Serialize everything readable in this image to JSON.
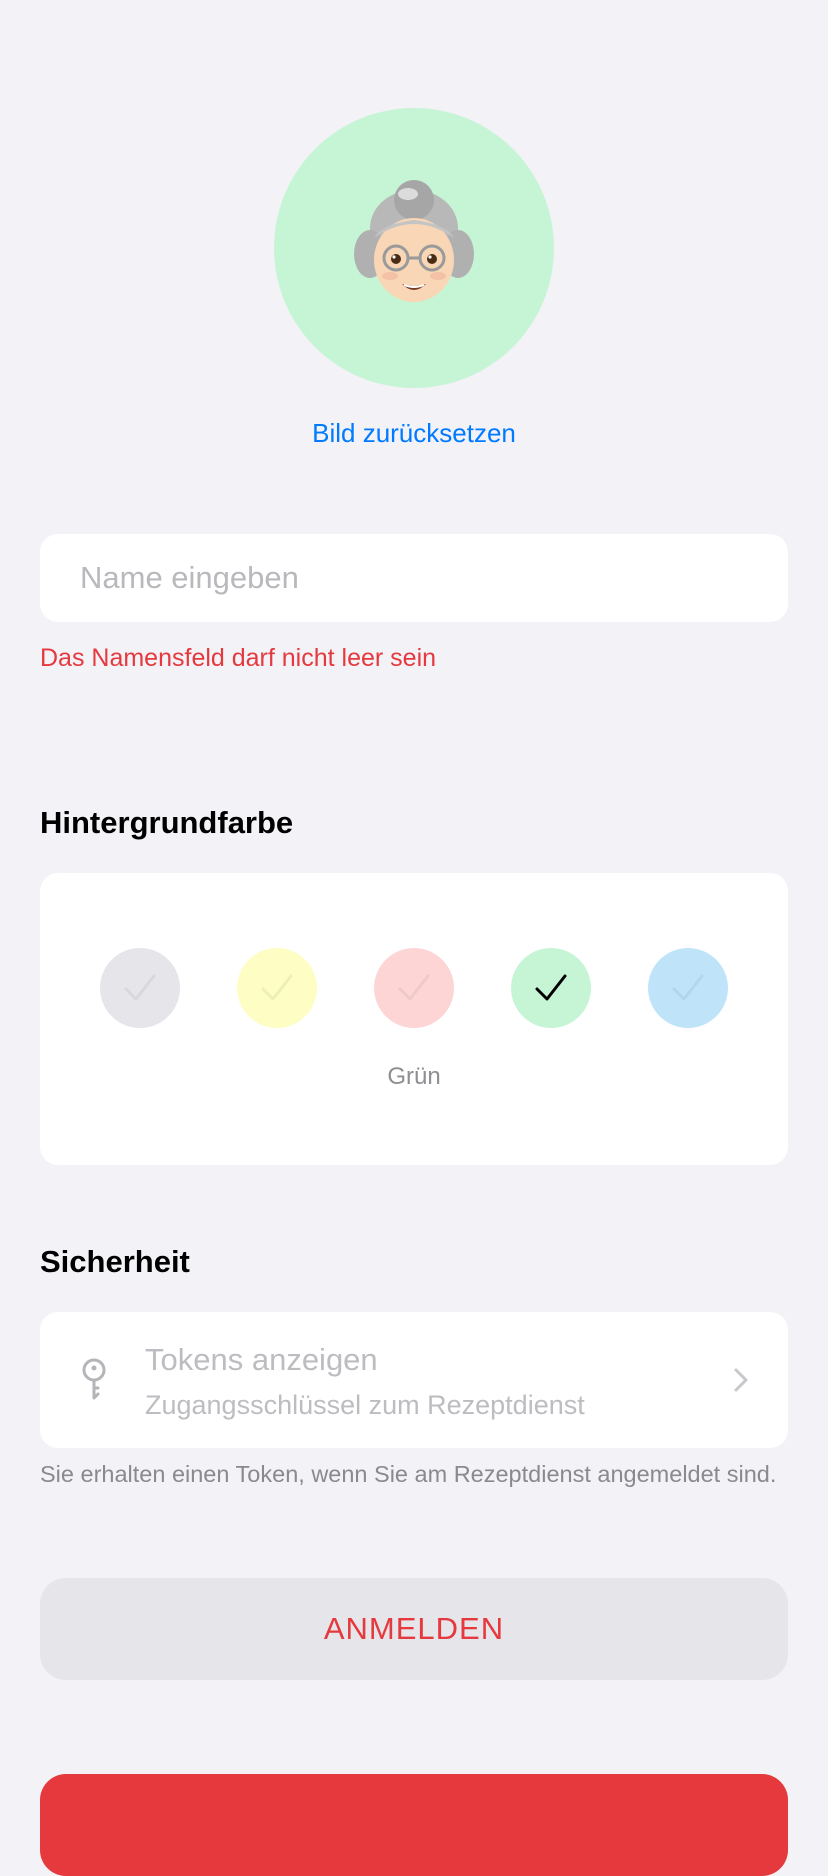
{
  "profile": {
    "avatar_icon": "grandma-emoji-icon",
    "reset_label": "Bild zurücksetzen"
  },
  "name_field": {
    "value": "",
    "placeholder": "Name eingeben",
    "error": "Das Namensfeld darf nicht leer sein"
  },
  "background": {
    "section_title": "Hintergrundfarbe",
    "swatches": [
      {
        "id": "grey",
        "color": "#e5e5ea",
        "selected": false
      },
      {
        "id": "yellow",
        "color": "#fdfdc4",
        "selected": false
      },
      {
        "id": "red",
        "color": "#fed5d5",
        "selected": false
      },
      {
        "id": "green",
        "color": "#c6f5d5",
        "selected": true
      },
      {
        "id": "blue",
        "color": "#bfe4fa",
        "selected": false
      }
    ],
    "selected_label": "Grün"
  },
  "security": {
    "section_title": "Sicherheit",
    "tokens_title": "Tokens anzeigen",
    "tokens_subtitle": "Zugangsschlüssel zum Rezeptdienst",
    "footnote": "Sie erhalten einen Token, wenn Sie am Rezeptdienst angemeldet sind."
  },
  "actions": {
    "login_label": "ANMELDEN",
    "login_color": "#e5393e",
    "delete_button_color": "#e5393e"
  }
}
